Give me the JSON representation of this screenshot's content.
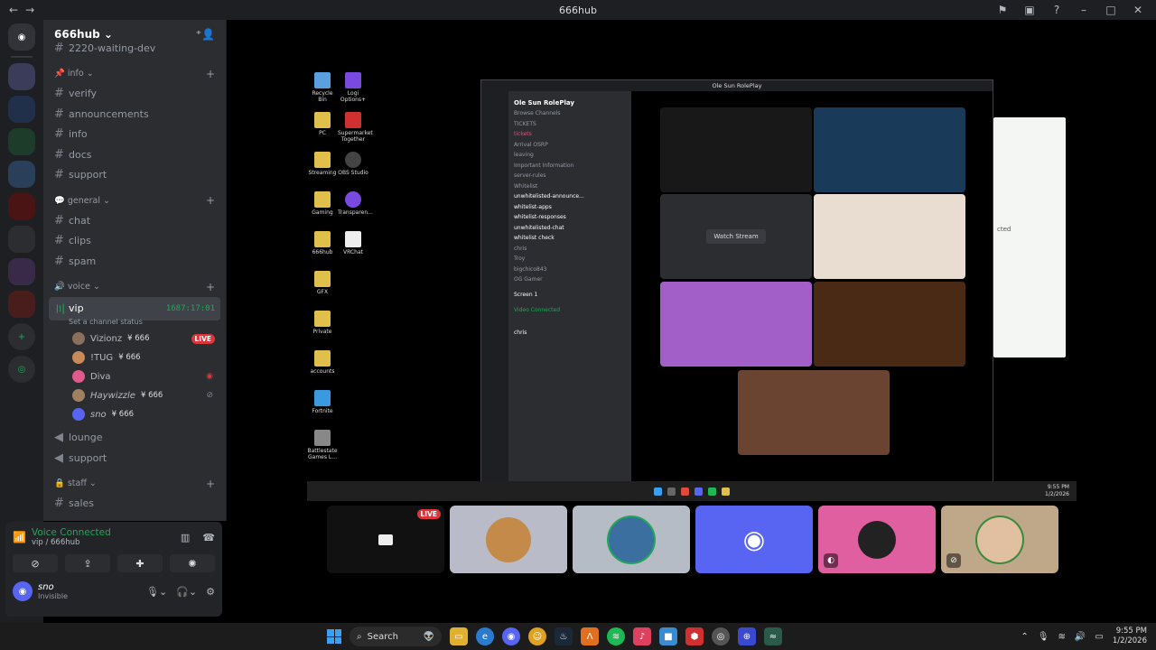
{
  "window": {
    "title": "666hub",
    "back": "←",
    "forward": "→"
  },
  "guild": {
    "name": "666hub",
    "partial_top_channel": "2220-waiting-dev",
    "categories": [
      {
        "name": "info",
        "channels": [
          "verify",
          "announcements",
          "info",
          "docs",
          "support"
        ]
      },
      {
        "name": "general",
        "channels": [
          "chat",
          "clips",
          "spam"
        ]
      }
    ],
    "voice_category": "voice",
    "active_channel": {
      "name": "vip",
      "timer": "1687:17:01",
      "status": "Set a channel status"
    },
    "voice_users": [
      {
        "name": "Vizionz",
        "tag": "666",
        "live": "LIVE",
        "color": "#8a6f5a"
      },
      {
        "name": "!TUG",
        "tag": "666",
        "color": "#c98a5a"
      },
      {
        "name": "Diva",
        "color": "#e05a8a"
      },
      {
        "name": "Haywizzle",
        "tag": "666",
        "color": "#a08060"
      },
      {
        "name": "sno",
        "tag": "666",
        "color": "#5865f2"
      }
    ],
    "other_voice": [
      "lounge",
      "support"
    ],
    "staff_category": "staff",
    "staff_channels": [
      "sales"
    ]
  },
  "voice_panel": {
    "title": "Voice Connected",
    "subtitle": "vip / 666hub"
  },
  "user": {
    "name": "sno",
    "status": "Invisible"
  },
  "screen": {
    "inner_title": "Ole Sun RolePlay",
    "inner_guild": "Ole Sun RolePlay",
    "inner_channels": [
      "Browse Channels",
      "TICKETS",
      "tickets",
      "Arrival OSRP",
      "leaving",
      "Important Information",
      "server-rules",
      "Whitelist",
      "unwhitelisted-announce...",
      "whitelist-apps",
      "whitelist-responses",
      "unwhitelisted-chat",
      "whitelist check",
      "chris",
      "Troy",
      "bigchico843",
      "OG Gamer"
    ],
    "watch_stream": "Watch Stream",
    "inner_voice": "Video Connected",
    "inner_screen": "Screen 1",
    "inner_user": "chris",
    "inner_clock_time": "9:55 PM",
    "inner_clock_date": "1/2/2026",
    "desktop_icons": [
      "Recycle Bin",
      "Logi Options+",
      "PC",
      "Supermarket Together",
      "Streaming",
      "OBS Studio",
      "Gaming",
      "Transparen...",
      "666hub",
      "VRChat",
      "GFX",
      "Private",
      "accounts",
      "Fortnite",
      "Battlestate Games L..."
    ],
    "green_window_text": "cted"
  },
  "tiles": [
    {
      "kind": "stream",
      "live": "LIVE",
      "bg": "#111111"
    },
    {
      "kind": "avatar",
      "bg": "#b9bcc8",
      "avatar_color": "#c48a4a"
    },
    {
      "kind": "avatar",
      "bg": "#b6bcc6",
      "avatar_color": "#3a6fa0"
    },
    {
      "kind": "avatar",
      "bg": "#5865f2",
      "avatar_color": "#5865f2"
    },
    {
      "kind": "avatar",
      "bg": "#e05fa0",
      "avatar_color": "#222222"
    },
    {
      "kind": "avatar",
      "bg": "#bfa88a",
      "avatar_color": "#3a8a3a"
    }
  ],
  "taskbar": {
    "search": "Search",
    "time": "9:55 PM",
    "date": "1/2/2026"
  }
}
